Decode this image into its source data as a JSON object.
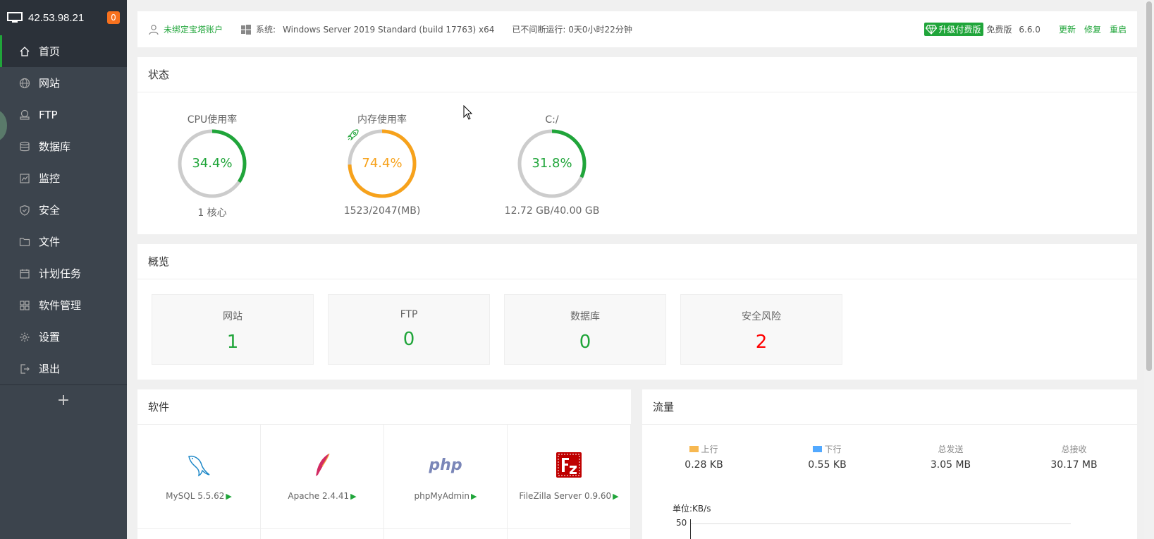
{
  "sidebar": {
    "ip": "42.53.98.21",
    "badge": "0",
    "items": [
      {
        "label": "首页",
        "icon": "home-icon"
      },
      {
        "label": "网站",
        "icon": "globe-icon"
      },
      {
        "label": "FTP",
        "icon": "ftp-icon"
      },
      {
        "label": "数据库",
        "icon": "database-icon"
      },
      {
        "label": "监控",
        "icon": "monitor-chart-icon"
      },
      {
        "label": "安全",
        "icon": "shield-icon"
      },
      {
        "label": "文件",
        "icon": "folder-icon"
      },
      {
        "label": "计划任务",
        "icon": "calendar-icon"
      },
      {
        "label": "软件管理",
        "icon": "grid-icon"
      },
      {
        "label": "设置",
        "icon": "gear-icon"
      },
      {
        "label": "退出",
        "icon": "logout-icon"
      }
    ],
    "add": "+"
  },
  "topbar": {
    "bind_account": "未绑定宝塔账户",
    "sys_label": "系统:",
    "sys_value": "Windows Server 2019 Standard (build 17763) x64",
    "uptime": "已不间断运行: 0天0小时22分钟",
    "upgrade": "升级付费版",
    "edition": "免费版",
    "version": "6.6.0",
    "update": "更新",
    "repair": "修复",
    "restart": "重启"
  },
  "status": {
    "title": "状态",
    "gauges": [
      {
        "label": "CPU使用率",
        "value": "34.4%",
        "fraction": 0.344,
        "sub": "1 核心",
        "color": "#20a53a"
      },
      {
        "label": "内存使用率",
        "value": "74.4%",
        "fraction": 0.744,
        "sub": "1523/2047(MB)",
        "color": "#f7a21b"
      },
      {
        "label": "C:/",
        "value": "31.8%",
        "fraction": 0.318,
        "sub": "12.72 GB/40.00 GB",
        "color": "#20a53a"
      }
    ]
  },
  "overview": {
    "title": "概览",
    "boxes": [
      {
        "label": "网站",
        "value": "1"
      },
      {
        "label": "FTP",
        "value": "0"
      },
      {
        "label": "数据库",
        "value": "0"
      },
      {
        "label": "安全风险",
        "value": "2"
      }
    ]
  },
  "software": {
    "title": "软件",
    "items": [
      {
        "name": "MySQL 5.5.62"
      },
      {
        "name": "Apache 2.4.41"
      },
      {
        "name": "phpMyAdmin"
      },
      {
        "name": "FileZilla Server 0.9.60"
      }
    ],
    "php_logo": "php",
    "play": "▶"
  },
  "traffic": {
    "title": "流量",
    "stats": [
      {
        "label": "上行",
        "value": "0.28 KB",
        "color": "#f7b851"
      },
      {
        "label": "下行",
        "value": "0.55 KB",
        "color": "#52a9ff"
      },
      {
        "label": "总发送",
        "value": "3.05 MB"
      },
      {
        "label": "总接收",
        "value": "30.17 MB"
      }
    ],
    "unit": "单位:KB/s",
    "tick": "50"
  }
}
